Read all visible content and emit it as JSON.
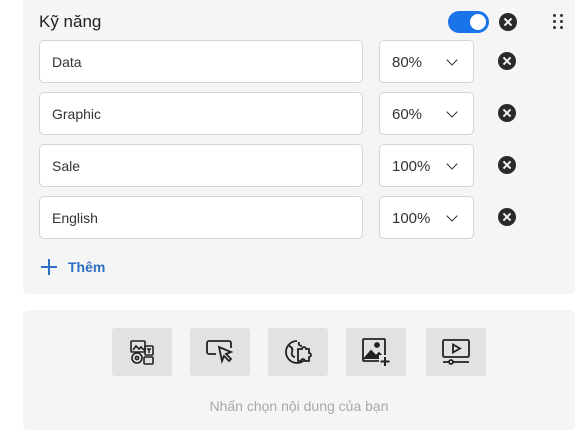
{
  "skills_section": {
    "title": "Kỹ năng",
    "enabled": true,
    "rows": [
      {
        "name": "Data",
        "level": "80%"
      },
      {
        "name": "Graphic",
        "level": "60%"
      },
      {
        "name": "Sale",
        "level": "100%"
      },
      {
        "name": "English",
        "level": "100%"
      }
    ],
    "add_label": "Thêm"
  },
  "content_picker": {
    "tools": [
      {
        "icon": "media-gallery-icon"
      },
      {
        "icon": "cursor-click-icon"
      },
      {
        "icon": "puzzle-globe-icon"
      },
      {
        "icon": "add-image-icon"
      },
      {
        "icon": "video-player-icon"
      }
    ],
    "hint": "Nhấn chọn nội dung của bạn"
  },
  "colors": {
    "accent": "#1a73e8",
    "link": "#2d6fc4",
    "panel_bg": "#f5f5f5",
    "tool_bg": "#e2e2e2"
  }
}
